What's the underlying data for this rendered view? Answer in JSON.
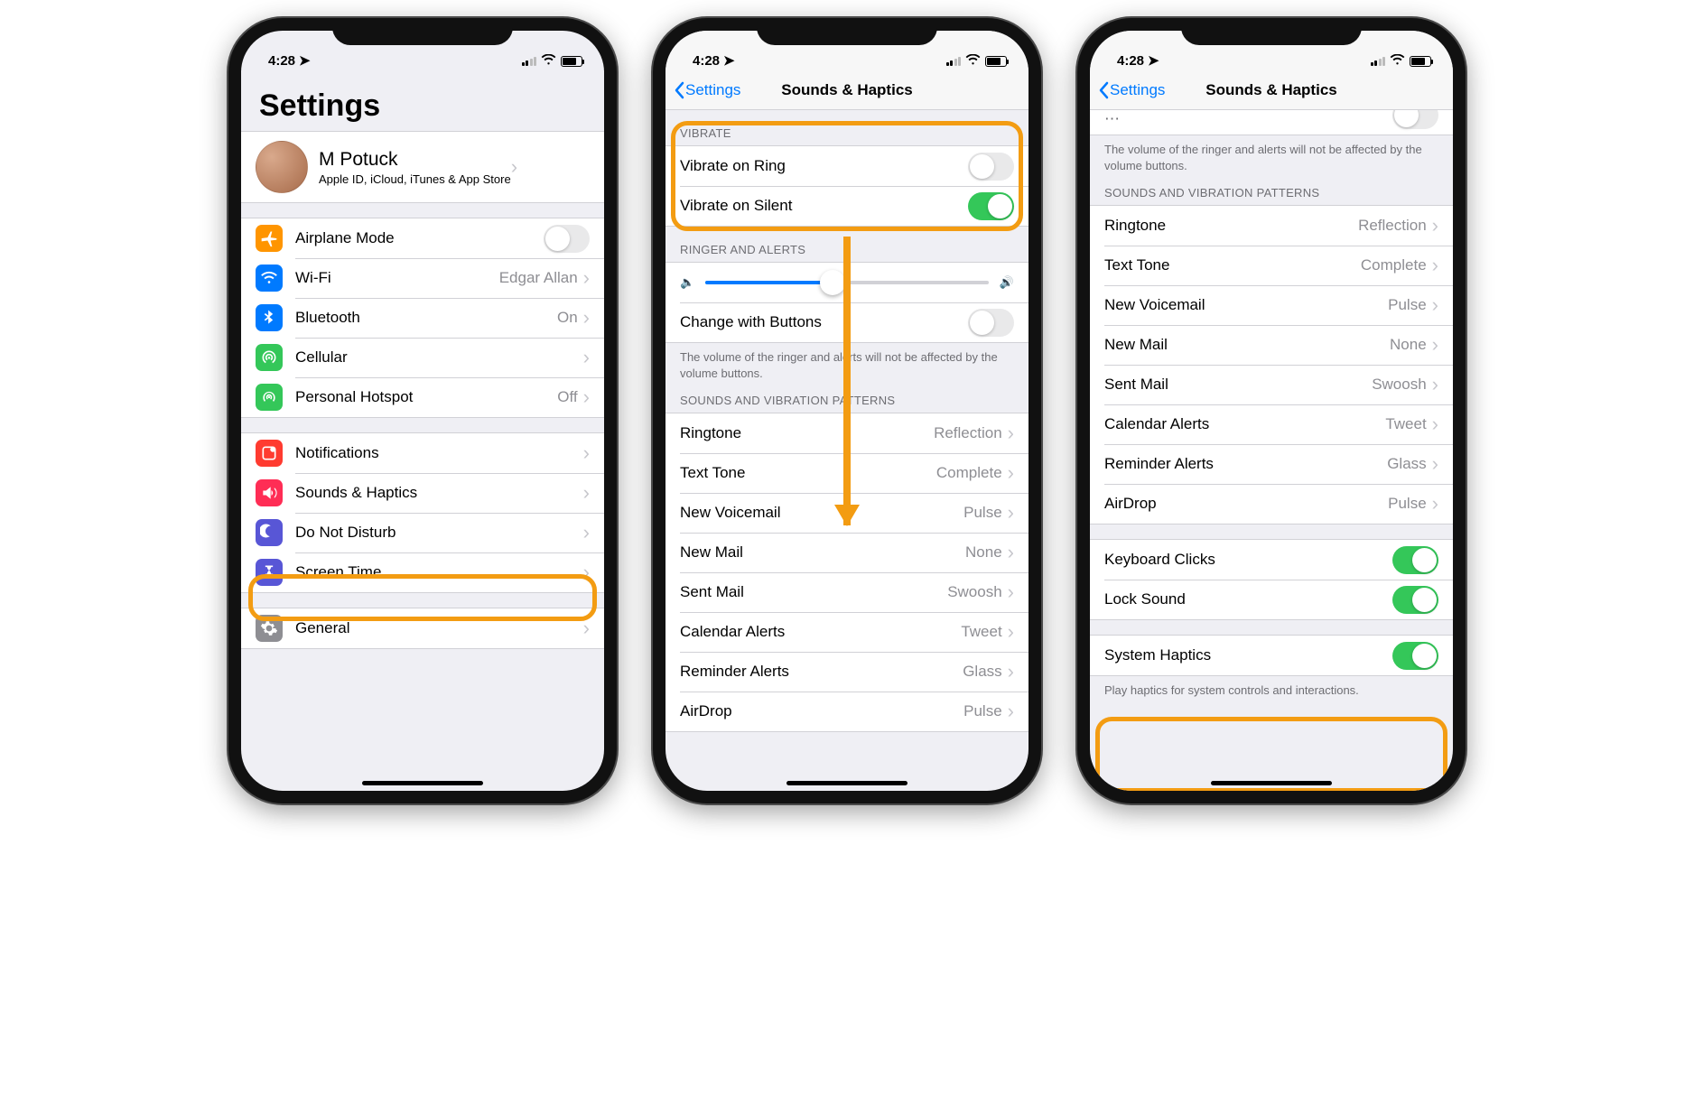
{
  "status": {
    "time": "4:28",
    "location_arrow": "➤"
  },
  "colors": {
    "accent_blue": "#007aff",
    "switch_green": "#34c759",
    "highlight_orange": "#f39c12"
  },
  "screen1": {
    "title": "Settings",
    "profile": {
      "name": "M Potuck",
      "subtitle": "Apple ID, iCloud, iTunes & App Store"
    },
    "group_a": [
      {
        "icon": "airplane",
        "color": "#ff9500",
        "label": "Airplane Mode",
        "control": "switch-off"
      },
      {
        "icon": "wifi",
        "color": "#007aff",
        "label": "Wi-Fi",
        "detail": "Edgar Allan"
      },
      {
        "icon": "bluetooth",
        "color": "#007aff",
        "label": "Bluetooth",
        "detail": "On"
      },
      {
        "icon": "cellular",
        "color": "#34c759",
        "label": "Cellular",
        "detail": ""
      },
      {
        "icon": "hotspot",
        "color": "#34c759",
        "label": "Personal Hotspot",
        "detail": "Off"
      }
    ],
    "group_b": [
      {
        "icon": "notifications",
        "color": "#ff3b30",
        "label": "Notifications"
      },
      {
        "icon": "sounds",
        "color": "#ff2d55",
        "label": "Sounds & Haptics"
      },
      {
        "icon": "dnd",
        "color": "#5856d6",
        "label": "Do Not Disturb"
      },
      {
        "icon": "screentime",
        "color": "#5856d6",
        "label": "Screen Time"
      }
    ],
    "group_c": [
      {
        "icon": "general",
        "color": "#8e8e93",
        "label": "General"
      }
    ]
  },
  "screen2": {
    "back": "Settings",
    "title": "Sounds & Haptics",
    "sec_vibrate": "VIBRATE",
    "vibrate_ring": "Vibrate on Ring",
    "vibrate_silent": "Vibrate on Silent",
    "sec_ringer": "RINGER AND ALERTS",
    "change_buttons": "Change with Buttons",
    "change_footer": "The volume of the ringer and alerts will not be affected by the volume buttons.",
    "sec_patterns": "SOUNDS AND VIBRATION PATTERNS",
    "patterns": [
      {
        "label": "Ringtone",
        "detail": "Reflection"
      },
      {
        "label": "Text Tone",
        "detail": "Complete"
      },
      {
        "label": "New Voicemail",
        "detail": "Pulse"
      },
      {
        "label": "New Mail",
        "detail": "None"
      },
      {
        "label": "Sent Mail",
        "detail": "Swoosh"
      },
      {
        "label": "Calendar Alerts",
        "detail": "Tweet"
      },
      {
        "label": "Reminder Alerts",
        "detail": "Glass"
      },
      {
        "label": "AirDrop",
        "detail": "Pulse"
      }
    ]
  },
  "screen3": {
    "back": "Settings",
    "title": "Sounds & Haptics",
    "partial_top_label": "Change with Buttons",
    "change_footer": "The volume of the ringer and alerts will not be affected by the volume buttons.",
    "sec_patterns": "SOUNDS AND VIBRATION PATTERNS",
    "patterns": [
      {
        "label": "Ringtone",
        "detail": "Reflection"
      },
      {
        "label": "Text Tone",
        "detail": "Complete"
      },
      {
        "label": "New Voicemail",
        "detail": "Pulse"
      },
      {
        "label": "New Mail",
        "detail": "None"
      },
      {
        "label": "Sent Mail",
        "detail": "Swoosh"
      },
      {
        "label": "Calendar Alerts",
        "detail": "Tweet"
      },
      {
        "label": "Reminder Alerts",
        "detail": "Glass"
      },
      {
        "label": "AirDrop",
        "detail": "Pulse"
      }
    ],
    "group_extra": [
      {
        "label": "Keyboard Clicks",
        "switch": "on"
      },
      {
        "label": "Lock Sound",
        "switch": "on"
      }
    ],
    "system_haptics": "System Haptics",
    "system_haptics_footer": "Play haptics for system controls and interactions."
  }
}
